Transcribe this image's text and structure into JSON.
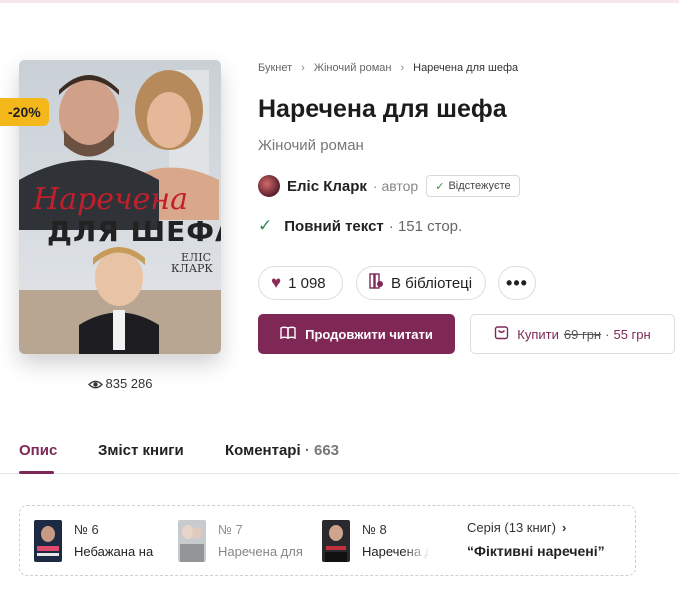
{
  "book": {
    "discount": "-20%",
    "cover_title_line1": "Наречена",
    "cover_title_line2": "ДЛЯ ШЕФА",
    "cover_author_line1": "ЕЛІС",
    "cover_author_line2": "КЛАРК",
    "views": "835 286",
    "title": "Наречена для шефа",
    "genre": "Жіночий роман",
    "author": "Еліс Кларк",
    "author_role": "· автор",
    "follow_label": "Відстежуєте",
    "fulltext_label": "Повний текст",
    "pages": "· 151 стор.",
    "likes": "1 098",
    "library_label": "В бібліотеці",
    "more_label": "•••",
    "read_label": "Продовжити читати",
    "buy_label": "Купити",
    "old_price": "69 грн",
    "price_sep": "·",
    "new_price": "55 грн"
  },
  "breadcrumb": {
    "root": "Букнет",
    "category": "Жіночий роман",
    "current": "Наречена для шефа"
  },
  "tabs": {
    "description": "Опис",
    "contents": "Зміст книги",
    "comments": "Коментарі",
    "comments_count": "· 663"
  },
  "series": {
    "items": [
      {
        "num": "№ 6",
        "name": "Небажана наречена"
      },
      {
        "num": "№ 7",
        "name": "Наречена для шефа"
      },
      {
        "num": "№ 8",
        "name": "Наречена для мажора"
      }
    ],
    "count_label": "Серія (13 книг)",
    "name": "“Фіктивні наречені”"
  },
  "colors": {
    "accent": "#7f2856",
    "discount": "#f5b81b",
    "check": "#2e8b57"
  }
}
